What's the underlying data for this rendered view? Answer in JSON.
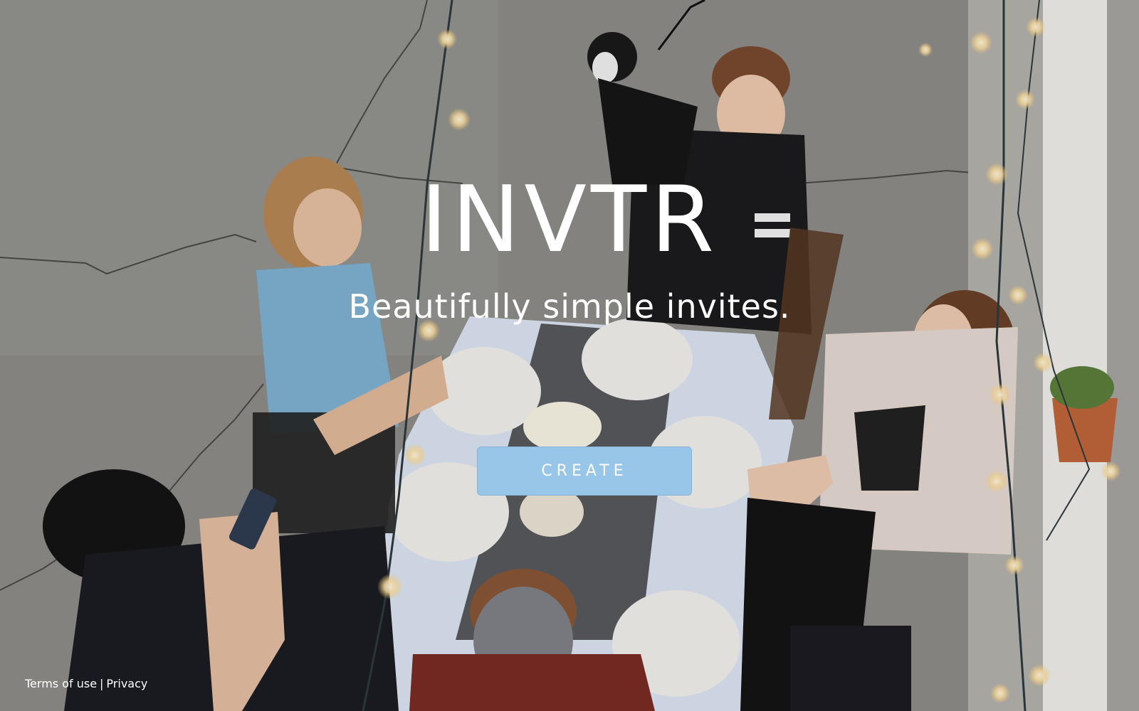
{
  "hero": {
    "brand": "INVTR",
    "tagline": "Beautifully simple invites.",
    "create_label": "CREATE"
  },
  "footer": {
    "terms_label": "Terms of use",
    "separator": "|",
    "privacy_label": "Privacy"
  },
  "colors": {
    "button_bg": "#98c6e9",
    "text": "#ffffff"
  }
}
